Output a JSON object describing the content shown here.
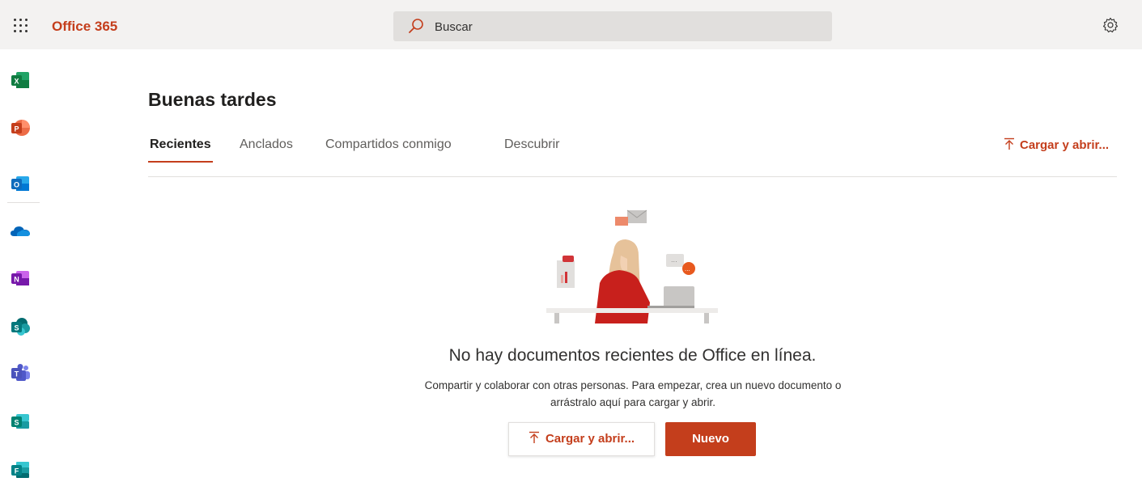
{
  "header": {
    "brand": "Office 365",
    "search_text": "Buscar",
    "waffle_icon": "app-launcher-icon",
    "settings_icon": "gear-icon"
  },
  "rail": {
    "apps": [
      {
        "name": "Excel",
        "icon": "excel-icon",
        "letter": "X",
        "color": "#107c41"
      },
      {
        "name": "PowerPoint",
        "icon": "powerpoint-icon",
        "letter": "P",
        "color": "#c43e1c"
      },
      {
        "name": "Outlook",
        "icon": "outlook-icon",
        "letter": "O",
        "color": "#0f6cbd"
      },
      {
        "name": "OneDrive",
        "icon": "onedrive-icon",
        "letter": "",
        "color": "#0364b8"
      },
      {
        "name": "OneNote",
        "icon": "onenote-icon",
        "letter": "N",
        "color": "#7719aa"
      },
      {
        "name": "SharePoint",
        "icon": "sharepoint-icon",
        "letter": "S",
        "color": "#03787c"
      },
      {
        "name": "Teams",
        "icon": "teams-icon",
        "letter": "T",
        "color": "#5b5fc7"
      },
      {
        "name": "Sway",
        "icon": "sway-icon",
        "letter": "S",
        "color": "#008272"
      },
      {
        "name": "Forms",
        "icon": "forms-icon",
        "letter": "F",
        "color": "#038387"
      }
    ]
  },
  "main": {
    "greeting": "Buenas tardes",
    "tabs": [
      {
        "label": "Recientes",
        "active": true
      },
      {
        "label": "Anclados",
        "active": false
      },
      {
        "label": "Compartidos conmigo",
        "active": false
      },
      {
        "label": "Descubrir",
        "active": false
      }
    ],
    "upload_link": "Cargar y abrir...",
    "empty_state": {
      "title": "No hay documentos recientes de Office en línea.",
      "description": "Compartir y colaborar con otras personas. Para empezar, crea un nuevo documento o arrástralo aquí para cargar y abrir.",
      "upload_button": "Cargar y abrir...",
      "new_button": "Nuevo"
    }
  },
  "colors": {
    "accent": "#c43e1c",
    "header_bg": "#f3f2f1",
    "search_bg": "#e1dfdd"
  }
}
